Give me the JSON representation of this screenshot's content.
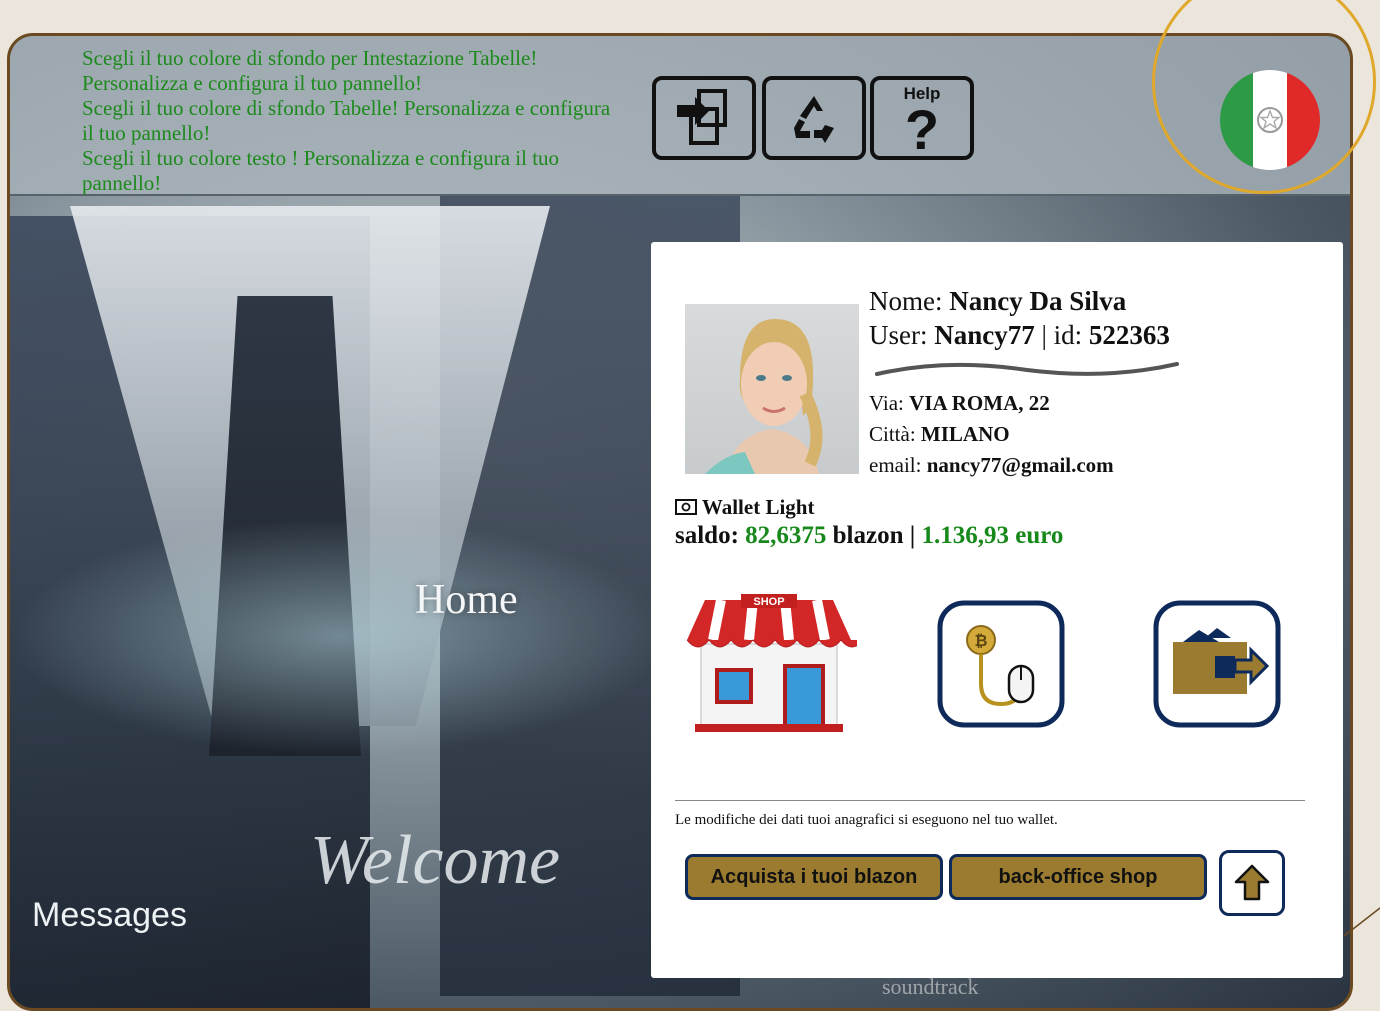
{
  "topbar": {
    "lines": [
      "Scegli il tuo colore di sfondo per Intestazione Tabelle!",
      "Personalizza e configura il tuo pannello!",
      "Scegli il tuo colore di sfondo Tabelle! Personalizza e configura",
      "il tuo pannello!",
      "Scegli il tuo colore testo ! Personalizza e configura il tuo",
      "pannello!"
    ],
    "help_label": "Help",
    "flag_colors": [
      "#2d9a45",
      "#ffffff",
      "#e02a2a"
    ]
  },
  "background": {
    "home": "Home",
    "welcome": "Welcome",
    "messages": "Messages",
    "soundtrack": "soundtrack"
  },
  "profile": {
    "name_label": "Nome:",
    "name": "Nancy Da Silva",
    "user_label": "User:",
    "user": "Nancy77",
    "id_sep": "| id:",
    "id": "522363",
    "street_label": "Via:",
    "street": "VIA ROMA, 22",
    "city_label": "Città:",
    "city": "MILANO",
    "email_label": "email:",
    "email": "nancy77@gmail.com"
  },
  "wallet": {
    "title": "Wallet Light",
    "saldo_label": "saldo:",
    "blazon_value": "82,6375",
    "blazon_unit": "blazon",
    "sep": "|",
    "euro_value": "1.136,93",
    "euro_unit": "euro"
  },
  "shop_sign": "SHOP",
  "note": "Le modifiche dei dati tuoi anagrafici si eseguono nel tuo wallet.",
  "buttons": {
    "buy": "Acquista i tuoi  blazon",
    "backoffice": "back-office shop"
  },
  "colors": {
    "gold": "#9a7b2f",
    "navy": "#0e2a5a",
    "green_text": "#17891b"
  }
}
